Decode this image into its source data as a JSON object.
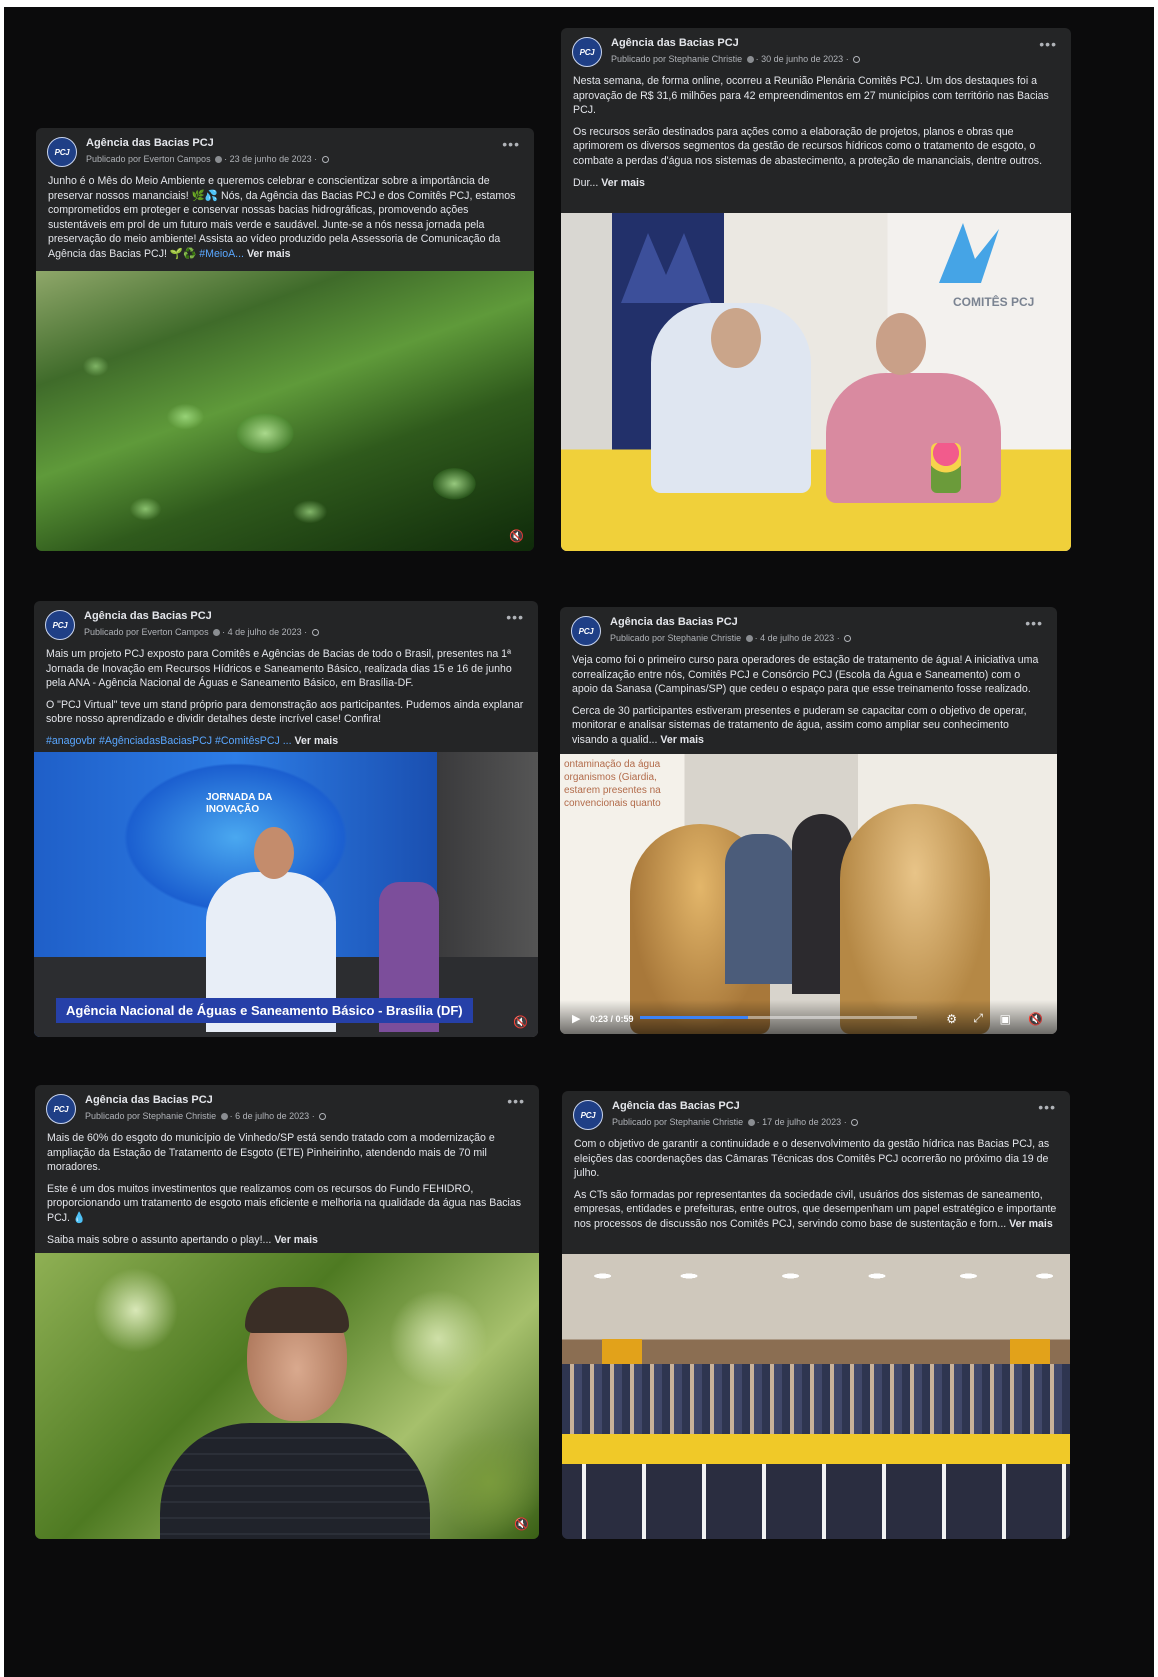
{
  "posts": [
    {
      "page": "Agência das Bacias PCJ",
      "avatar": "PCJ",
      "author": "Publicado por Everton Campos",
      "date": "23 de junho de 2023",
      "paragraphs": [
        "Junho é o Mês do Meio Ambiente e queremos celebrar e conscientizar sobre a importância de preservar nossos mananciais! 🌿💦 Nós, da Agência das Bacias PCJ e dos Comitês PCJ, estamos comprometidos em proteger e conservar nossas bacias hidrográficas, promovendo ações sustentáveis em prol de um futuro mais verde e saudável. Junte-se a nós nessa jornada pela preservação do meio ambiente! Assista ao vídeo produzido pela Assessoria de Comunicação da Agência das Bacias PCJ! 🌱♻️"
      ],
      "hashtags": "#MeioA...",
      "see_more": "Ver mais",
      "media": "leaf-water-drops-video",
      "mute_icon": "muted-speaker-icon"
    },
    {
      "page": "Agência das Bacias PCJ",
      "avatar": "PCJ",
      "author": "Publicado por Stephanie Christie",
      "date": "30 de junho de 2023",
      "paragraphs": [
        "Nesta semana, de forma online, ocorreu a Reunião Plenária Comitês PCJ. Um dos destaques foi a aprovação de R$ 31,6 milhões para 42 empreendimentos em 27 municípios com território nas Bacias PCJ.",
        "Os recursos serão destinados para ações como a elaboração de projetos, planos e obras que aprimorem os diversos segmentos da gestão de recursos hídricos como o tratamento de esgoto, o combate a perdas d'água nos sistemas de abastecimento, a proteção de mananciais, dentre outros.",
        "Dur..."
      ],
      "hashtags": "",
      "see_more": "Ver mais",
      "media": "meeting-photo",
      "media_text": "COMITÊS PCJ"
    },
    {
      "page": "Agência das Bacias PCJ",
      "avatar": "PCJ",
      "author": "Publicado por Everton Campos",
      "date": "4 de julho de 2023",
      "paragraphs": [
        "Mais um projeto PCJ exposto para Comitês e Agências de Bacias de todo o Brasil, presentes na 1ª Jornada de Inovação em Recursos Hídricos e Saneamento Básico, realizada dias 15 e 16 de junho pela ANA - Agência Nacional de Águas e Saneamento Básico, em Brasília-DF.",
        "O \"PCJ Virtual\" teve um stand próprio para demonstração aos participantes. Pudemos ainda explanar sobre nosso aprendizado e dividir detalhes deste incrível case! Confira!"
      ],
      "hashtags": "#anagovbr #AgênciadasBaciasPCJ #ComitêsPCJ ...",
      "see_more": "Ver mais",
      "media": "stand-video",
      "media_text": "JORNADA DA INOVAÇÃO",
      "caption": "Agência Nacional de Águas e Saneamento Básico - Brasília (DF)",
      "mute_icon": "muted-speaker-icon"
    },
    {
      "page": "Agência das Bacias PCJ",
      "avatar": "PCJ",
      "author": "Publicado por Stephanie Christie",
      "date": "4 de julho de 2023",
      "paragraphs": [
        "Veja como foi o primeiro curso para operadores de estação de tratamento de água! A iniciativa uma correalização entre nós, Comitês PCJ e Consórcio PCJ (Escola da Água e Saneamento) com o apoio da Sanasa (Campinas/SP) que cedeu o espaço para que esse treinamento fosse realizado.",
        "Cerca de 30 participantes estiveram presentes e puderam se capacitar com o objetivo de operar, monitorar e analisar sistemas de tratamento de água, assim como ampliar seu conhecimento visando a qualid..."
      ],
      "hashtags": "",
      "see_more": "Ver mais",
      "media": "classroom-video",
      "slide_text": "ontaminação da água\norganismos (Giardia,\nestarem presentes na\nconvencionais quanto",
      "video": {
        "time": "0:23 / 0:59",
        "progress": 0.39
      }
    },
    {
      "page": "Agência das Bacias PCJ",
      "avatar": "PCJ",
      "author": "Publicado por Stephanie Christie",
      "date": "6 de julho de 2023",
      "paragraphs": [
        "Mais de 60% do esgoto do município de Vinhedo/SP está sendo tratado com a modernização e ampliação da Estação de Tratamento de Esgoto (ETE) Pinheirinho, atendendo mais de 70 mil moradores.",
        "Este é um dos muitos investimentos que realizamos com os recursos do Fundo FEHIDRO, proporcionando um tratamento de esgoto mais eficiente e melhoria na qualidade da água nas Bacias PCJ. 💧",
        "Saiba mais sobre o assunto apertando o play!..."
      ],
      "hashtags": "",
      "see_more": "Ver mais",
      "media": "portrait-video",
      "mute_icon": "muted-speaker-icon"
    },
    {
      "page": "Agência das Bacias PCJ",
      "avatar": "PCJ",
      "author": "Publicado por Stephanie Christie",
      "date": "17 de julho de 2023",
      "paragraphs": [
        "Com o objetivo de garantir a continuidade e o desenvolvimento da gestão hídrica nas Bacias PCJ, as eleições das coordenações das Câmaras Técnicas dos Comitês PCJ ocorrerão no próximo dia 19 de julho.",
        "As CTs são formadas por representantes da sociedade civil, usuários dos sistemas de saneamento, empresas, entidades e prefeituras, entre outros, que desempenham um papel estratégico e importante nos processos de discussão nos Comitês PCJ, servindo como base de sustentação e forn..."
      ],
      "hashtags": "",
      "see_more": "Ver mais",
      "media": "auditorium-photo"
    }
  ],
  "more_icon_glyph": "•••",
  "mute_glyph": "🔇"
}
